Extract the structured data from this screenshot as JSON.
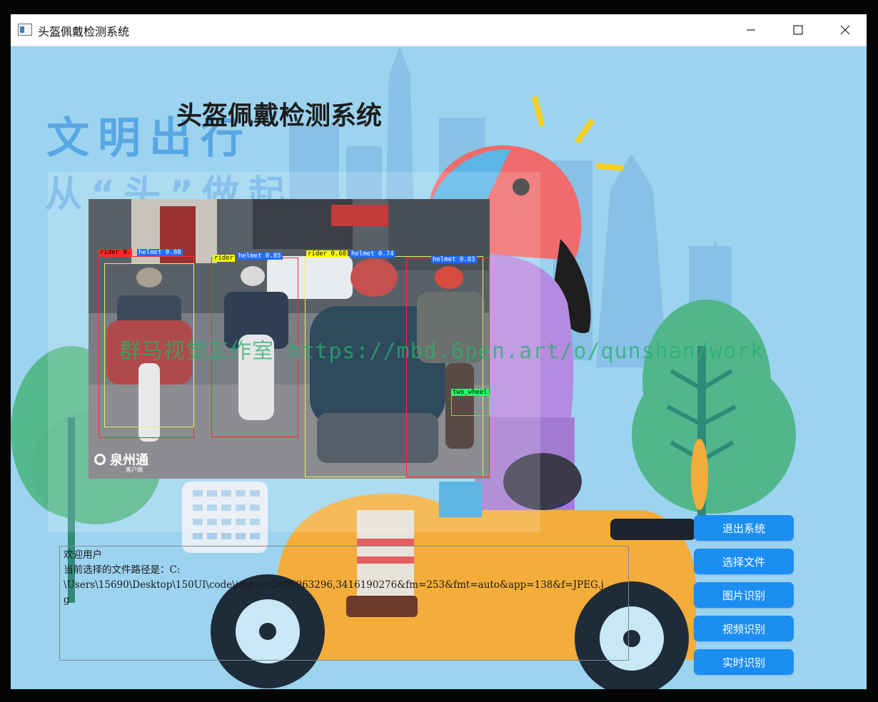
{
  "window": {
    "title": "头盔佩戴检测系统",
    "controls": {
      "minimize": "minimize-icon",
      "maximize": "maximize-icon",
      "close": "close-icon"
    }
  },
  "background": {
    "slogan_line1": "文明出行",
    "slogan_line2": "从“头”做起"
  },
  "header": {
    "title": "头盔佩戴检测系统"
  },
  "image_view": {
    "detections": [
      {
        "label": "rider 0.",
        "color": "#ff2a2a"
      },
      {
        "label": "helmet 0.88",
        "color": "#1f6dff"
      },
      {
        "label": "rider",
        "color": "#ffff00"
      },
      {
        "label": "helmet 0.85",
        "color": "#1f6dff"
      },
      {
        "label": "rider 0.60",
        "color": "#ffff00"
      },
      {
        "label": "helmet 0.74",
        "color": "#1f6dff"
      },
      {
        "label": "helmet 0.83",
        "color": "#1f6dff"
      },
      {
        "label": "two_wheel",
        "color": "#22ff66"
      }
    ],
    "logo_text": "泉州通",
    "logo_sub": "客户端",
    "watermark": "群马视觉工作室 https://mbd.6pen.art/o/qunshan/work"
  },
  "log": {
    "lines": [
      "欢迎用户",
      "当前选择的文件路径是：C:",
      "\\Users\\15690\\Desktop\\150UI\\code\\img\\u=2696963296,3416190276&fm=253&fmt=auto&app=138&f=JPEG.j",
      "g"
    ]
  },
  "buttons": {
    "exit": "退出系统",
    "choose_file": "选择文件",
    "image_detect": "图片识别",
    "video_detect": "视频识别",
    "realtime_detect": "实时识别"
  },
  "colors": {
    "background": "#9cd4f0",
    "button": "#1c8ef2",
    "slogan": "#4e9fe3"
  }
}
